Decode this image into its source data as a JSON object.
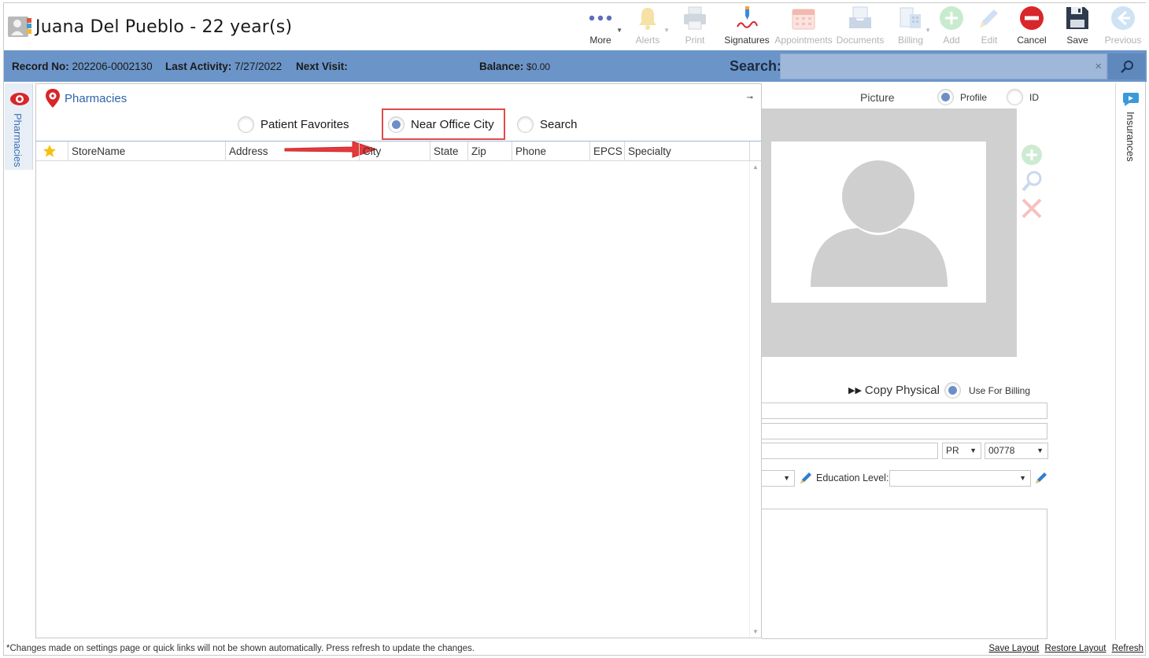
{
  "header": {
    "patient_name": "Juana Del Pueblo - 22 year(s)"
  },
  "toolbar": [
    {
      "label": "More",
      "icon": "more-dots-icon",
      "enabled": true,
      "caret": true
    },
    {
      "label": "Alerts",
      "icon": "bell-icon",
      "enabled": false,
      "caret": true
    },
    {
      "label": "Print",
      "icon": "printer-icon",
      "enabled": false,
      "caret": false
    },
    {
      "label": "Signatures",
      "icon": "signature-pen-icon",
      "enabled": true,
      "caret": false
    },
    {
      "label": "Appointments",
      "icon": "calendar-icon",
      "enabled": false,
      "caret": false
    },
    {
      "label": "Documents",
      "icon": "documents-tray-icon",
      "enabled": false,
      "caret": false
    },
    {
      "label": "Billing",
      "icon": "billing-icon",
      "enabled": false,
      "caret": true
    },
    {
      "label": "Add",
      "icon": "add-plus-icon",
      "enabled": false,
      "caret": false
    },
    {
      "label": "Edit",
      "icon": "pencil-icon",
      "enabled": false,
      "caret": false
    },
    {
      "label": "Cancel",
      "icon": "cancel-icon",
      "enabled": true,
      "caret": false
    },
    {
      "label": "Save",
      "icon": "floppy-disk-icon",
      "enabled": true,
      "caret": false
    },
    {
      "label": "Previous",
      "icon": "arrow-left-icon",
      "enabled": false,
      "caret": false
    }
  ],
  "info_bar": {
    "record_label": "Record No:",
    "record_value": "202206-0002130",
    "activity_label": "Last Activity:",
    "activity_value": "7/27/2022",
    "next_visit_label": "Next Visit:",
    "balance_label": "Balance:",
    "balance_value": "$0.00",
    "search_label": "Search:",
    "search_value": "",
    "search_clear": "×"
  },
  "side_tabs": {
    "left": "Pharmacies",
    "right": "Insurances"
  },
  "pharmacies": {
    "title": "Pharmacies",
    "pin_glyph": "⊸",
    "radio_options": [
      {
        "label": "Patient Favorites",
        "selected": false
      },
      {
        "label": "Near Office City",
        "selected": true
      },
      {
        "label": "Search",
        "selected": false
      }
    ],
    "columns": [
      "StoreName",
      "Address",
      "City",
      "State",
      "Zip",
      "Phone",
      "EPCS",
      "Specialty"
    ],
    "rows": []
  },
  "picture": {
    "title": "Picture",
    "options": [
      {
        "label": "Profile",
        "selected": true
      },
      {
        "label": "ID",
        "selected": false
      }
    ]
  },
  "address": {
    "copy_label": "Copy Physical",
    "use_for_billing": "Use For Billing",
    "state_value": "PR",
    "zip_value": "00778",
    "education_label": "Education Level:",
    "education_value": ""
  },
  "footer": {
    "note": "*Changes made on settings page or quick links will not be shown automatically. Press refresh to update the changes.",
    "save_layout": "Save Layout",
    "restore_layout": "Restore Layout",
    "refresh": "Refresh"
  },
  "colors": {
    "info_bar": "#6b95c8",
    "accent_blue": "#2f64a8",
    "highlight_red": "#e04b4b"
  }
}
